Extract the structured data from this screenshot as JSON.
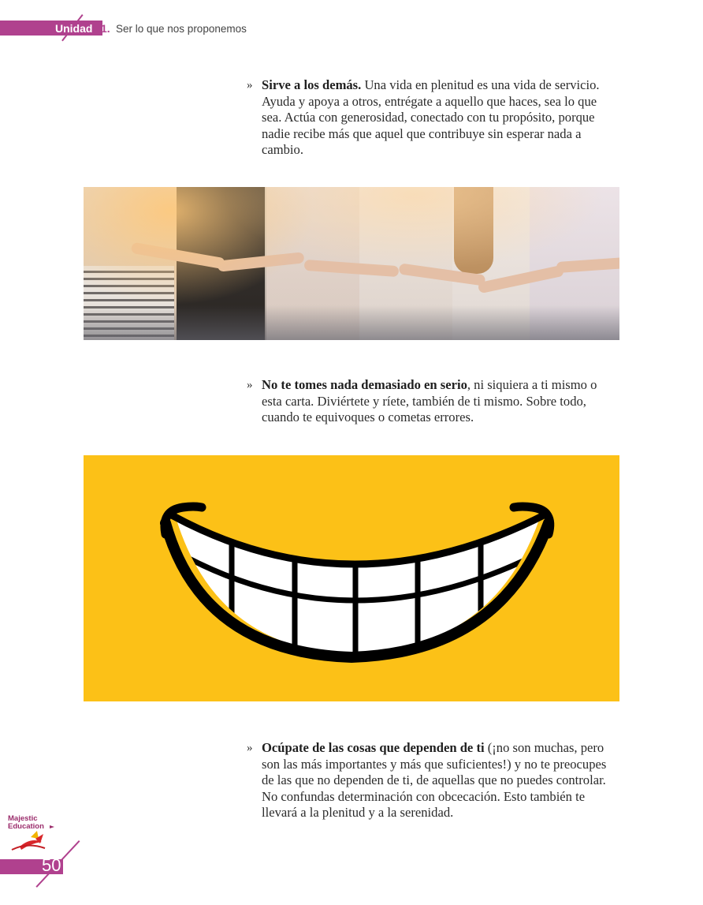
{
  "header": {
    "unit_label": "Unidad",
    "unit_number": "1.",
    "title": "Ser lo que nos proponemos"
  },
  "bullets": [
    {
      "marker": "»",
      "bold": "Sirve a los demás.",
      "text": " Una vida en plenitud es una vida de servicio. Ayuda y apoya a otros, entrégate a aquello que haces, sea lo que sea. Actúa con generosidad, conectado con tu propósito, porque nadie recibe más que aquel que contribuye sin esperar nada a cambio."
    },
    {
      "marker": "»",
      "bold": "No te tomes nada demasiado en serio",
      "text": ", ni siquiera a ti mismo o esta carta. Diviértete y ríete, también de ti mismo. Sobre todo, cuando te equivoques o cometas errores."
    },
    {
      "marker": "»",
      "bold": "Ocúpate de las cosas que dependen de ti",
      "text": " (¡no son muchas, pero son las más importantes y más que suficientes!) y no te preocupes de las que no dependen de ti, de aquellas que no puedes controlar. No confundas determinación con obcecación. Esto también te llevará a la plenitud y a la serenidad."
    }
  ],
  "images": {
    "photo_icon": "people-holding-hands-photo",
    "smile_icon": "smile-icon",
    "smile_background": "#fcc117"
  },
  "footer": {
    "logo_line1": "Majestic",
    "logo_line2": "Education",
    "page_number": "50"
  },
  "colors": {
    "accent": "#b0418e"
  }
}
